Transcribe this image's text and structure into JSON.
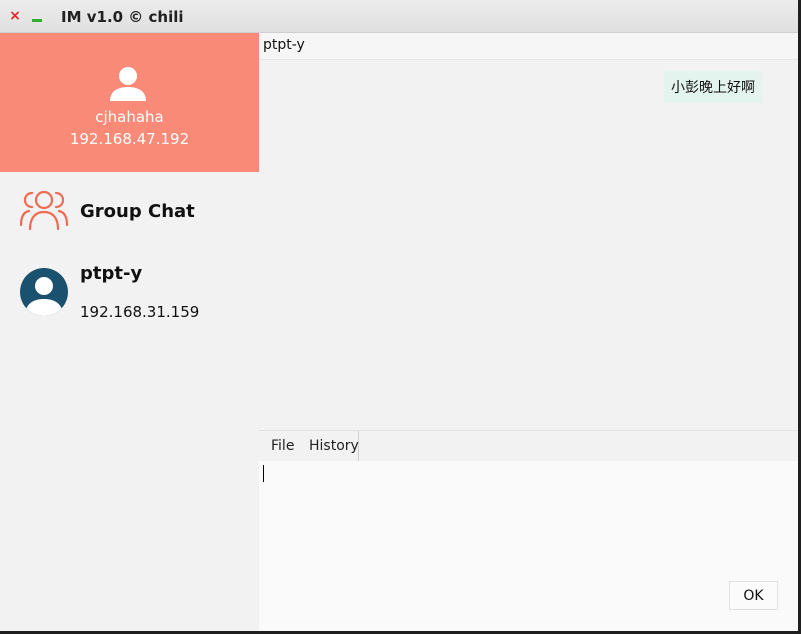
{
  "window": {
    "title": "IM v1.0 © chili",
    "close_glyph": "×",
    "minimize_glyph": "–"
  },
  "profile": {
    "username": "cjhahaha",
    "ip": "192.168.47.192",
    "background": "#fa8a78",
    "icon": "user-icon"
  },
  "contacts": {
    "group": {
      "label": "Group Chat",
      "icon": "group-icon",
      "color": "#f06b52"
    },
    "peer": {
      "name": "ptpt-y",
      "ip": "192.168.31.159",
      "icon": "user-avatar-icon",
      "color": "#19516e"
    }
  },
  "chat": {
    "header_title": "ptpt-y",
    "messages": [
      {
        "text": "小彭晚上好啊",
        "side": "right"
      }
    ]
  },
  "toolbar": {
    "file_label": "File",
    "history_label": "History"
  },
  "composer": {
    "value": "",
    "send_label": "OK"
  }
}
